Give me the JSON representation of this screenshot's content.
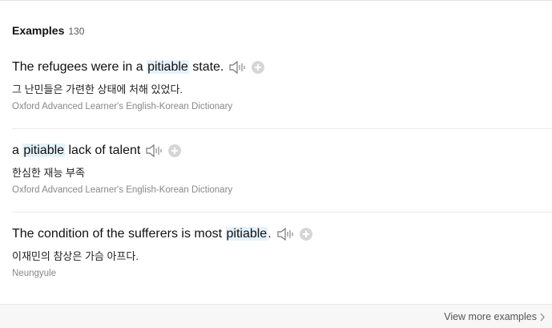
{
  "section": {
    "title": "Examples",
    "count": "130"
  },
  "examples": [
    {
      "before": "The refugees were in a ",
      "highlight": "pitiable",
      "after": " state.",
      "translation": "그 난민들은 가련한 상태에 처해 있었다.",
      "source": "Oxford Advanced Learner's English-Korean Dictionary"
    },
    {
      "before": "a ",
      "highlight": "pitiable",
      "after": " lack of talent",
      "translation": "한심한 재능 부족",
      "source": "Oxford Advanced Learner's English-Korean Dictionary"
    },
    {
      "before": "The condition of the sufferers is most ",
      "highlight": "pitiable",
      "after": ".",
      "translation": "이재민의 참상은 가슴 아프다.",
      "source": "Neungyule"
    }
  ],
  "footer": {
    "view_more_label": "View more examples"
  },
  "icons": {
    "speaker": "speaker-icon",
    "add": "plus-circle-icon",
    "chevron": "chevron-right-icon"
  },
  "colors": {
    "highlight": "#e5f2fb",
    "icon_gray": "#d6d6d6",
    "source_gray": "#888888"
  }
}
